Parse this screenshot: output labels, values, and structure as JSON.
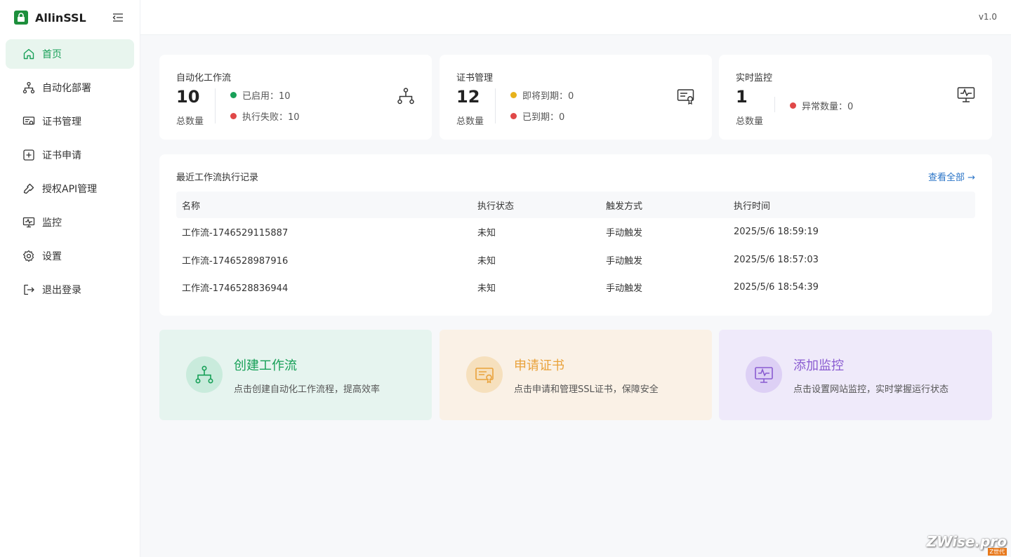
{
  "brand": {
    "name": "AllinSSL",
    "version": "v1.0"
  },
  "sidebar": {
    "items": [
      {
        "label": "首页",
        "icon": "home-icon",
        "active": true
      },
      {
        "label": "自动化部署",
        "icon": "workflow-icon"
      },
      {
        "label": "证书管理",
        "icon": "certificate-icon"
      },
      {
        "label": "证书申请",
        "icon": "plus-square-icon"
      },
      {
        "label": "授权API管理",
        "icon": "key-icon"
      },
      {
        "label": "监控",
        "icon": "monitor-icon"
      },
      {
        "label": "设置",
        "icon": "gear-icon"
      },
      {
        "label": "退出登录",
        "icon": "logout-icon"
      }
    ]
  },
  "stats": {
    "workflow": {
      "title": "自动化工作流",
      "total": "10",
      "total_label": "总数量",
      "enabled_label": "已启用：10",
      "failed_label": "执行失败：10"
    },
    "certs": {
      "title": "证书管理",
      "total": "12",
      "total_label": "总数量",
      "expiring_label": "即将到期：0",
      "expired_label": "已到期：0"
    },
    "monitor": {
      "title": "实时监控",
      "total": "1",
      "total_label": "总数量",
      "abnormal_label": "异常数量：0"
    }
  },
  "records": {
    "title": "最近工作流执行记录",
    "view_all": "查看全部 →",
    "columns": [
      "名称",
      "执行状态",
      "触发方式",
      "执行时间"
    ],
    "rows": [
      {
        "name": "工作流-1746529115887",
        "status": "未知",
        "trigger": "手动触发",
        "time": "2025/5/6 18:59:19"
      },
      {
        "name": "工作流-1746528987916",
        "status": "未知",
        "trigger": "手动触发",
        "time": "2025/5/6 18:57:03"
      },
      {
        "name": "工作流-1746528836944",
        "status": "未知",
        "trigger": "手动触发",
        "time": "2025/5/6 18:54:39"
      }
    ]
  },
  "actions": [
    {
      "title": "创建工作流",
      "desc": "点击创建自动化工作流程，提高效率",
      "color": "#18a058",
      "bg": "#e6f4ef",
      "circle": "#c9ebdc"
    },
    {
      "title": "申请证书",
      "desc": "点击申请和管理SSL证书，保障安全",
      "color": "#e9a23b",
      "bg": "#faf1e6",
      "circle": "#f6e0bd"
    },
    {
      "title": "添加监控",
      "desc": "点击设置网站监控，实时掌握运行状态",
      "color": "#8a5cd1",
      "bg": "#efeafa",
      "circle": "#ddd0f5"
    }
  ],
  "colors": {
    "green": "#18a058",
    "red": "#e04848",
    "yellow": "#e7b21b",
    "link": "#2a74c7"
  },
  "watermark": {
    "text": "ZWise.pro",
    "tag": "Z世代"
  }
}
